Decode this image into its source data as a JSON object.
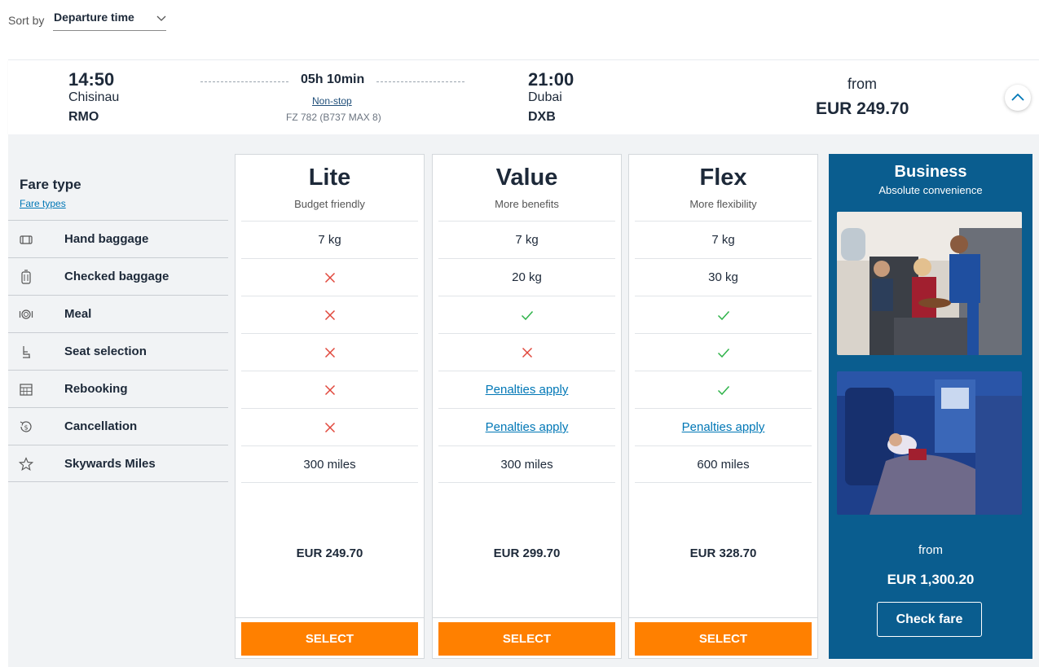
{
  "sort": {
    "label": "Sort by",
    "selected": "Departure time"
  },
  "flight": {
    "departure": {
      "time": "14:50",
      "city": "Chisinau",
      "code": "RMO"
    },
    "arrival": {
      "time": "21:00",
      "city": "Dubai",
      "code": "DXB"
    },
    "duration": "05h 10min",
    "stops": "Non-stop",
    "flight_number": "FZ 782 (B737 MAX 8)",
    "from_label": "from",
    "from_price": "EUR 249.70"
  },
  "features": {
    "title": "Fare type",
    "link": "Fare types",
    "rows": [
      {
        "label": "Hand baggage",
        "icon": "suitcase-icon"
      },
      {
        "label": "Checked baggage",
        "icon": "luggage-icon"
      },
      {
        "label": "Meal",
        "icon": "meal-icon"
      },
      {
        "label": "Seat selection",
        "icon": "seat-icon"
      },
      {
        "label": "Rebooking",
        "icon": "calendar-icon"
      },
      {
        "label": "Cancellation",
        "icon": "refund-icon"
      },
      {
        "label": "Skywards Miles",
        "icon": "star-icon"
      }
    ]
  },
  "fares": [
    {
      "name": "Lite",
      "subtitle": "Budget friendly",
      "cells": [
        {
          "type": "text",
          "value": "7 kg"
        },
        {
          "type": "cross"
        },
        {
          "type": "cross"
        },
        {
          "type": "cross"
        },
        {
          "type": "cross"
        },
        {
          "type": "cross"
        },
        {
          "type": "text",
          "value": "300 miles"
        }
      ],
      "price": "EUR 249.70",
      "button": "SELECT"
    },
    {
      "name": "Value",
      "subtitle": "More benefits",
      "cells": [
        {
          "type": "text",
          "value": "7 kg"
        },
        {
          "type": "text",
          "value": "20 kg"
        },
        {
          "type": "check"
        },
        {
          "type": "cross"
        },
        {
          "type": "link",
          "value": "Penalties apply"
        },
        {
          "type": "link",
          "value": "Penalties apply"
        },
        {
          "type": "text",
          "value": "300 miles"
        }
      ],
      "price": "EUR 299.70",
      "button": "SELECT"
    },
    {
      "name": "Flex",
      "subtitle": "More flexibility",
      "cells": [
        {
          "type": "text",
          "value": "7 kg"
        },
        {
          "type": "text",
          "value": "30 kg"
        },
        {
          "type": "check"
        },
        {
          "type": "check"
        },
        {
          "type": "check"
        },
        {
          "type": "link",
          "value": "Penalties apply"
        },
        {
          "type": "text",
          "value": "600 miles"
        }
      ],
      "price": "EUR 328.70",
      "button": "SELECT"
    }
  ],
  "business": {
    "name": "Business",
    "subtitle": "Absolute convenience",
    "from_label": "from",
    "price": "EUR 1,300.20",
    "button": "Check fare"
  },
  "colors": {
    "accent_orange": "#ff8000",
    "business_blue": "#0a5d8f",
    "link_blue": "#0077b6",
    "check_green": "#2fb34a",
    "cross_red": "#e0473b"
  }
}
